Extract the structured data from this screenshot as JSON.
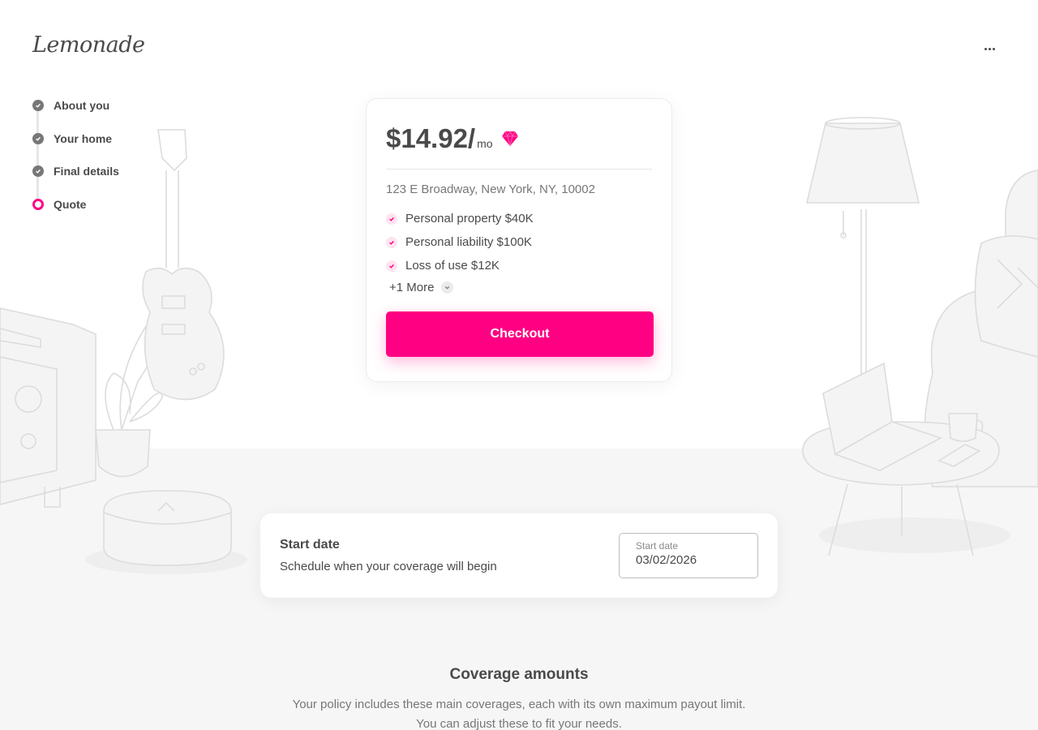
{
  "brand": {
    "logo_text": "Lemonade"
  },
  "header": {
    "menu_icon": "more-horizontal-icon"
  },
  "steps": [
    {
      "label": "About you",
      "status": "complete"
    },
    {
      "label": "Your home",
      "status": "complete"
    },
    {
      "label": "Final details",
      "status": "complete"
    },
    {
      "label": "Quote",
      "status": "current"
    }
  ],
  "quote": {
    "price": "$14.92/",
    "period": "mo",
    "badge_icon": "gem-icon",
    "address": "123 E Broadway, New York, NY, 10002",
    "coverages": [
      {
        "label": "Personal property $40K"
      },
      {
        "label": "Personal liability $100K"
      },
      {
        "label": "Loss of use $12K"
      }
    ],
    "more_label": "+1 More",
    "checkout_label": "Checkout"
  },
  "start_date": {
    "title": "Start date",
    "subtitle": "Schedule when your coverage will begin",
    "field_label": "Start date",
    "field_value": "03/02/2026"
  },
  "coverage_amounts": {
    "heading": "Coverage amounts",
    "description_line1": "Your policy includes these main coverages, each with its own maximum payout limit.",
    "description_line2": "You can adjust these to fit your needs."
  },
  "colors": {
    "accent": "#ff0083",
    "text": "#4a4a4a",
    "muted": "#777777"
  }
}
